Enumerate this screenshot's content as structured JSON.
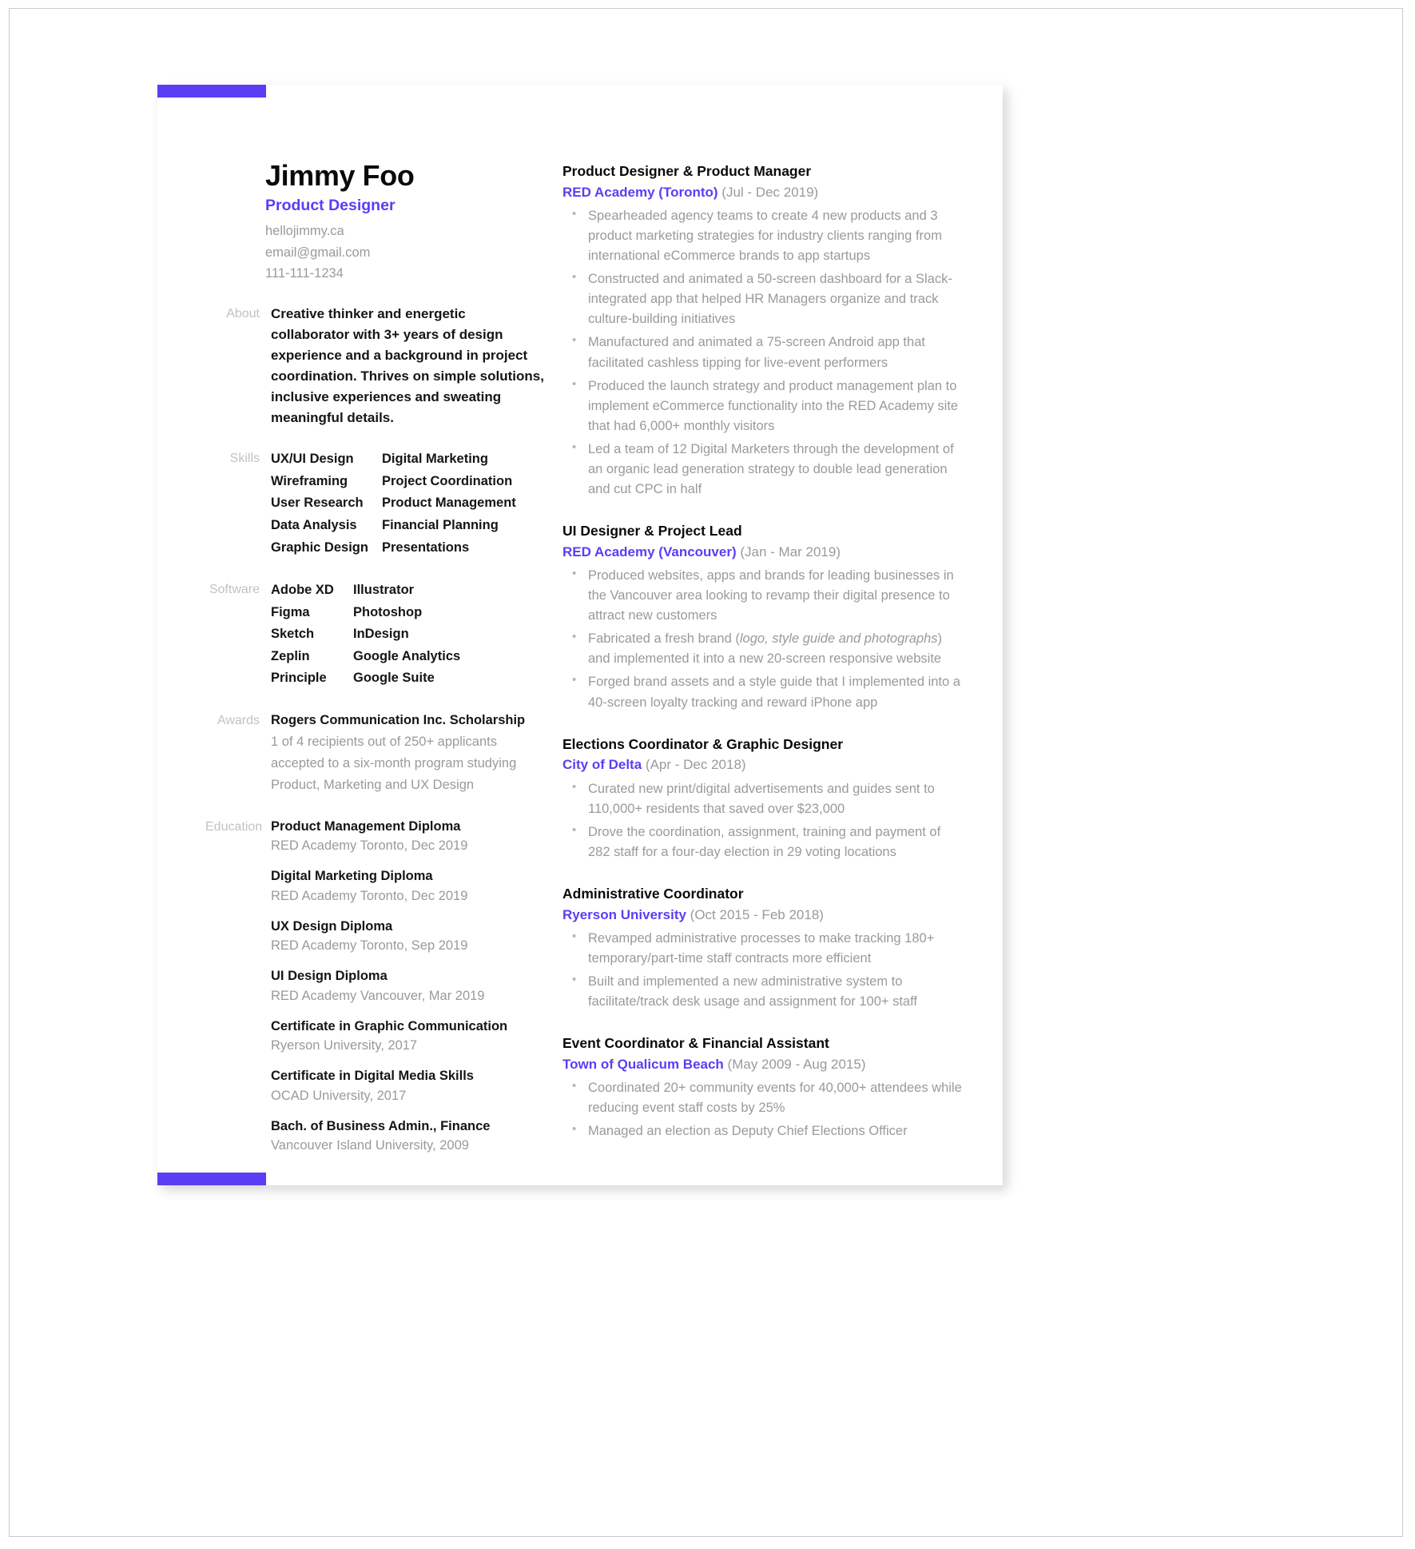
{
  "theme": {
    "accent": "#5b3df5",
    "text_dark": "#151515",
    "text_muted": "#9a9a9a",
    "label_grey": "#c2c2c2"
  },
  "header": {
    "name": "Jimmy Foo",
    "role": "Product Designer",
    "website": "hellojimmy.ca",
    "email": "email@gmail.com",
    "phone": "111-111-1234"
  },
  "left": {
    "about": {
      "label": "About",
      "text": "Creative thinker and energetic collaborator with 3+ years of design experience and a background in project coordination. Thrives on simple solutions, inclusive experiences and sweating meaningful details."
    },
    "skills": {
      "label": "Skills",
      "col_a": [
        "UX/UI Design",
        "Wireframing",
        "User Research",
        "Data Analysis",
        "Graphic Design"
      ],
      "col_b": [
        "Digital Marketing",
        "Project Coordination",
        "Product Management",
        "Financial Planning",
        "Presentations"
      ]
    },
    "software": {
      "label": "Software",
      "col_a": [
        "Adobe XD",
        "Figma",
        "Sketch",
        "Zeplin",
        "Principle"
      ],
      "col_b": [
        "Illustrator",
        "Photoshop",
        "InDesign",
        "Google Analytics",
        "Google Suite"
      ]
    },
    "awards": {
      "label": "Awards",
      "title": "Rogers Communication Inc. Scholarship",
      "description": "1 of 4 recipients out of 250+ applicants accepted to a six-month program studying Product, Marketing and UX Design"
    },
    "education": {
      "label": "Education",
      "items": [
        {
          "degree": "Product Management Diploma",
          "school": "RED Academy Toronto, Dec 2019"
        },
        {
          "degree": "Digital Marketing Diploma",
          "school": "RED Academy Toronto, Dec 2019"
        },
        {
          "degree": "UX Design Diploma",
          "school": "RED Academy Toronto, Sep 2019"
        },
        {
          "degree": "UI Design Diploma",
          "school": "RED Academy Vancouver, Mar 2019"
        },
        {
          "degree": "Certificate in Graphic Communication",
          "school": "Ryerson University, 2017"
        },
        {
          "degree": "Certificate in Digital Media Skills",
          "school": "OCAD University, 2017"
        },
        {
          "degree": "Bach. of Business Admin., Finance",
          "school": "Vancouver Island University, 2009"
        }
      ]
    }
  },
  "experience": [
    {
      "title": "Product Designer & Product Manager",
      "company": "RED Academy (Toronto)",
      "dates": "(Jul - Dec 2019)",
      "bullets": [
        "Spearheaded agency teams to create 4 new products and 3 product marketing strategies for industry clients ranging from international eCommerce brands to app startups",
        "Constructed and animated a 50-screen dashboard for a Slack-integrated app that helped HR Managers organize and track culture-building initiatives",
        "Manufactured and animated a 75-screen Android app that facilitated cashless tipping for live-event performers",
        "Produced the launch strategy and product management plan to implement eCommerce functionality into the RED Academy site that had 6,000+ monthly visitors",
        "Led a team of 12 Digital Marketers through the development of an organic lead generation strategy to double lead generation and cut CPC in half"
      ]
    },
    {
      "title": "UI Designer & Project Lead",
      "company": "RED Academy (Vancouver)",
      "dates": "(Jan - Mar 2019)",
      "bullets": [
        "Produced websites, apps and brands for leading businesses in the Vancouver area looking to revamp their digital presence to attract new customers",
        "Fabricated a fresh brand (logo, style guide and photographs) and implemented it into a new 20-screen responsive website",
        "Forged brand assets and a style guide that I implemented into a 40-screen loyalty tracking and reward iPhone app"
      ]
    },
    {
      "title": "Elections Coordinator & Graphic Designer",
      "company": "City of Delta",
      "dates": "(Apr - Dec 2018)",
      "bullets": [
        "Curated new print/digital advertisements and guides sent to 110,000+ residents that saved over $23,000",
        "Drove the coordination, assignment, training and payment of 282 staff for a four-day election in 29 voting locations"
      ]
    },
    {
      "title": "Administrative Coordinator",
      "company": "Ryerson University",
      "dates": "(Oct 2015 - Feb 2018)",
      "bullets": [
        "Revamped administrative processes to make tracking 180+ temporary/part-time staff contracts more efficient",
        "Built and implemented a new administrative system to facilitate/track desk usage and assignment for 100+ staff"
      ]
    },
    {
      "title": "Event Coordinator & Financial Assistant",
      "company": "Town of Qualicum Beach",
      "dates": "(May 2009 - Aug 2015)",
      "bullets": [
        "Coordinated 20+ community events for 40,000+ attendees while reducing event staff costs by 25%",
        "Managed an election as Deputy Chief Elections Officer"
      ]
    }
  ]
}
